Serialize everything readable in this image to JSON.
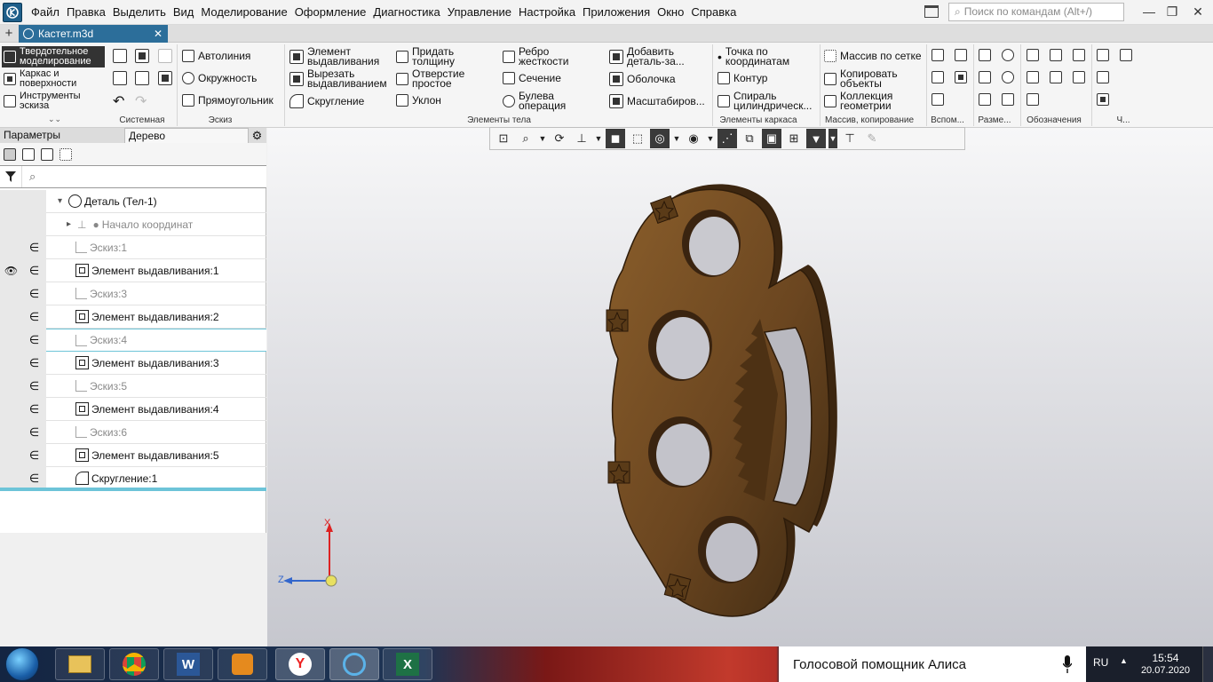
{
  "app": {
    "title": "КОМПАС-3D"
  },
  "menu": [
    "Файл",
    "Правка",
    "Выделить",
    "Вид",
    "Моделирование",
    "Оформление",
    "Диагностика",
    "Управление",
    "Настройка",
    "Приложения",
    "Окно",
    "Справка"
  ],
  "search": {
    "placeholder": "Поиск по командам (Alt+/)"
  },
  "tab": {
    "name": "Кастет.m3d",
    "add_label": "+",
    "close_label": "✕"
  },
  "modes": [
    {
      "label": "Твердотельное моделирование"
    },
    {
      "label": "Каркас и поверхности"
    },
    {
      "label": "Инструменты эскиза"
    }
  ],
  "ribbon": {
    "groups": [
      "Системная",
      "Эскиз",
      "Элементы тела",
      "Элементы каркаса",
      "Массив, копирование",
      "Вспом...",
      "Разме...",
      "Обозначения",
      "Ч..."
    ],
    "sketch": [
      "Автолиния",
      "Окружность",
      "Прямоугольник"
    ],
    "body": [
      "Элемент выдавливания",
      "Вырезать выдавливанием",
      "Скругление",
      "Придать толщину",
      "Отверстие простое",
      "Уклон",
      "Ребро жесткости",
      "Сечение",
      "Булева операция",
      "Добавить деталь-за...",
      "Оболочка",
      "Масштабиров..."
    ],
    "frame": [
      "Точка по координатам",
      "Контур",
      "Спираль цилиндрическ..."
    ],
    "array": [
      "Массив по сетке",
      "Копировать объекты",
      "Коллекция геометрии"
    ]
  },
  "panel": {
    "tabs": [
      "Параметры",
      "Дерево"
    ],
    "filter_icon": "search-icon",
    "tree": [
      {
        "label": "Деталь (Тел-1)",
        "dim": false,
        "icon": "part"
      },
      {
        "label": "Начало координат",
        "dim": true,
        "icon": "origin"
      },
      {
        "label": "Эскиз:1",
        "dim": true,
        "icon": "sketch"
      },
      {
        "label": "Элемент выдавливания:1",
        "dim": false,
        "icon": "extrude",
        "visible": true
      },
      {
        "label": "Эскиз:3",
        "dim": true,
        "icon": "sketch"
      },
      {
        "label": "Элемент выдавливания:2",
        "dim": false,
        "icon": "cut"
      },
      {
        "label": "Эскиз:4",
        "dim": true,
        "icon": "sketch"
      },
      {
        "label": "Элемент выдавливания:3",
        "dim": false,
        "icon": "cut"
      },
      {
        "label": "Эскиз:5",
        "dim": true,
        "icon": "sketch"
      },
      {
        "label": "Элемент выдавливания:4",
        "dim": false,
        "icon": "cut"
      },
      {
        "label": "Эскиз:6",
        "dim": true,
        "icon": "sketch"
      },
      {
        "label": "Элемент выдавливания:5",
        "dim": false,
        "icon": "cut"
      },
      {
        "label": "Скругление:1",
        "dim": false,
        "icon": "fillet"
      }
    ]
  },
  "axes": {
    "x": "X",
    "z": "Z"
  },
  "colors": {
    "model": "#6e4a22",
    "model_dark": "#3e2710",
    "accent": "#2c6e9a",
    "selection": "#6dc4d8"
  },
  "taskbar": {
    "assistant": "Голосовой помощник Алиса",
    "lang": "RU",
    "time": "15:54",
    "date": "20.07.2020",
    "apps": [
      "file-explorer-icon",
      "chrome-icon",
      "word-icon",
      "media-player-icon",
      "yandex-browser-icon",
      "kompas-icon",
      "excel-icon"
    ]
  }
}
